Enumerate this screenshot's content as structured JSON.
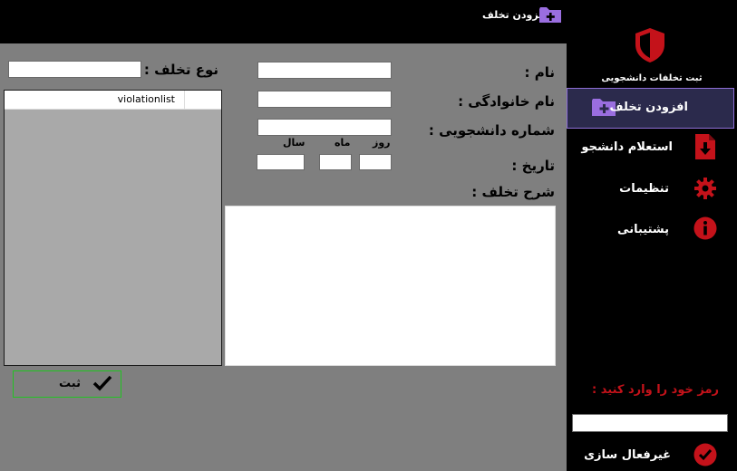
{
  "titlebar": {
    "title": "افزودن تخلف",
    "icon": "add-folder-icon",
    "controls": [
      "minimize-icon",
      "maximize-icon",
      "close-icon"
    ]
  },
  "sidebar": {
    "brand_icon": "shield-icon",
    "brand_title": "ثبت تخلفات دانشجویی",
    "items": [
      {
        "label": "افزودن تخلف",
        "icon": "add-folder-icon",
        "active": true
      },
      {
        "label": "استعلام دانشجو",
        "icon": "download-file-icon"
      },
      {
        "label": "تنظیمات",
        "icon": "gear-icon"
      },
      {
        "label": "پشتیبانی",
        "icon": "info-icon"
      }
    ],
    "password_prompt": "رمز خود را وارد کنید :",
    "password_value": "",
    "deactivate_label": "غیرفعال سازی"
  },
  "form": {
    "name_label": "نام :",
    "family_label": "نام خانوادگی :",
    "student_id_label": "شماره دانشجویی :",
    "date_label": "تاریخ :",
    "day_label": "روز",
    "month_label": "ماه",
    "year_label": "سال",
    "description_label": "شرح تخلف :",
    "violation_type_label": "نوع تخلف :",
    "list_header": "violationlist",
    "submit_label": "ثبت",
    "name_value": "",
    "family_value": "",
    "student_id_value": "",
    "day_value": "",
    "month_value": "",
    "year_value": "",
    "description_value": "",
    "violation_type_value": ""
  },
  "colors": {
    "accent_red": "#c4121a",
    "accent_purple": "#9a6ee0",
    "main_bg": "#7f7f7f",
    "sidebar_bg": "#000000",
    "submit_border": "#22c322"
  }
}
